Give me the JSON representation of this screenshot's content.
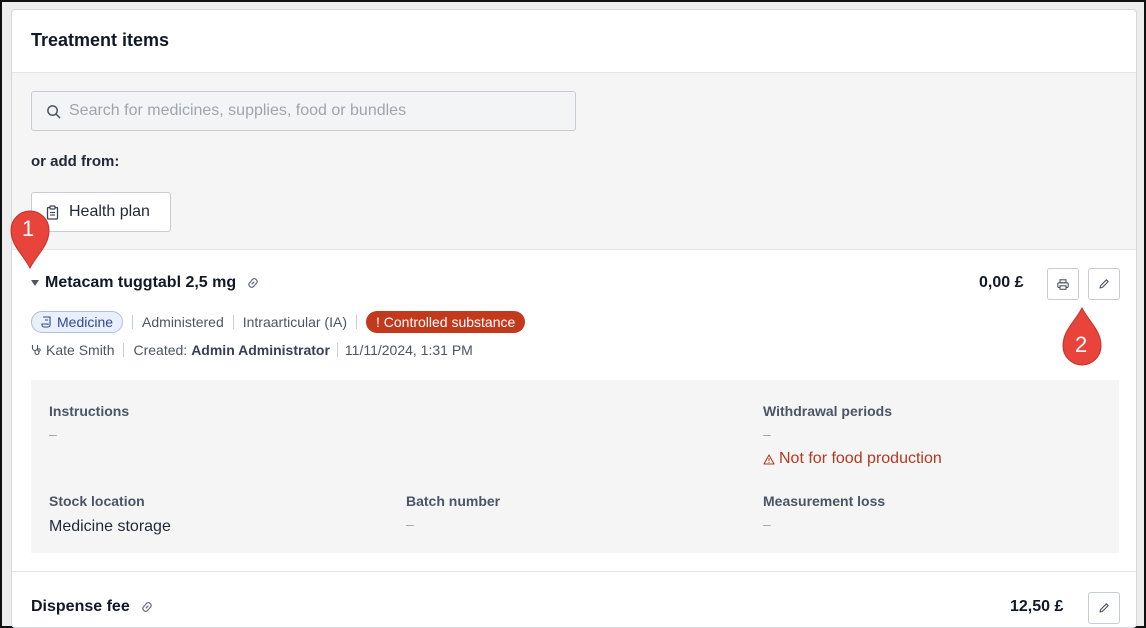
{
  "panel": {
    "title": "Treatment items"
  },
  "search": {
    "placeholder": "Search for medicines, supplies, food or bundles",
    "icon": "search-icon"
  },
  "add_from": {
    "label": "or add from:",
    "health_plan_label": "Health plan",
    "icon": "clipboard-icon"
  },
  "item1": {
    "name": "Metacam tuggtabl 2,5 mg",
    "price": "0,00 £",
    "tags": {
      "medicine": "Medicine",
      "administered": "Administered",
      "route": "Intraarticular (IA)",
      "controlled": "! Controlled substance"
    },
    "meta": {
      "vet": "Kate Smith",
      "created_label": "Created:",
      "created_by": "Admin Administrator",
      "created_at": "11/11/2024, 1:31 PM"
    },
    "details": {
      "instructions_label": "Instructions",
      "instructions_value": "–",
      "withdrawal_label": "Withdrawal periods",
      "withdrawal_value": "–",
      "withdrawal_warning": "Not for food production",
      "stock_label": "Stock location",
      "stock_value": "Medicine storage",
      "batch_label": "Batch number",
      "batch_value": "–",
      "loss_label": "Measurement loss",
      "loss_value": "–"
    }
  },
  "item2": {
    "name": "Dispense fee",
    "price": "12,50 £"
  },
  "callouts": {
    "one": "1",
    "two": "2"
  },
  "colors": {
    "controlled": "#c2391b",
    "medicine_tag": "#e9effb",
    "warning": "#b23a1c",
    "callout": "#e8443c"
  }
}
